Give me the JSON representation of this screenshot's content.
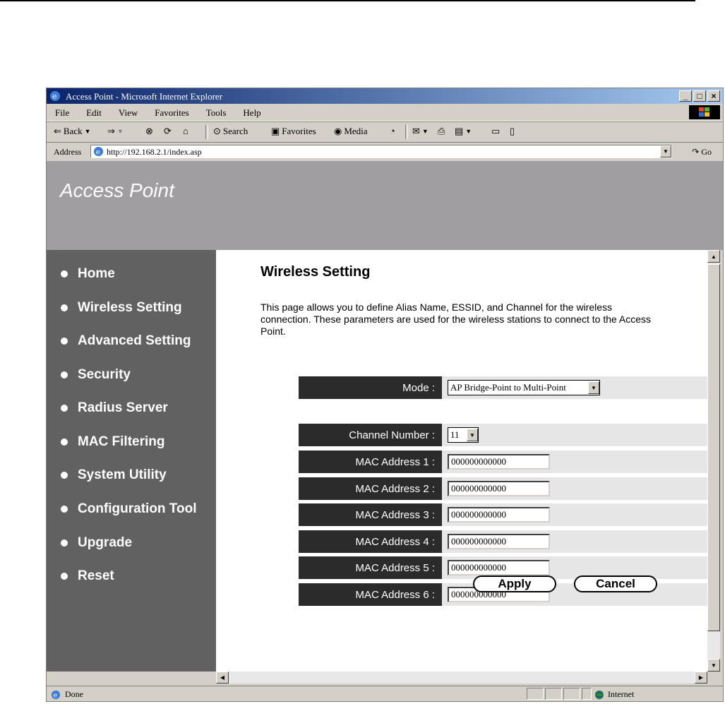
{
  "window": {
    "title": "Access Point - Microsoft Internet Explorer",
    "controls": {
      "minimize": "_",
      "maximize": "□",
      "close": "×"
    }
  },
  "menu": [
    "File",
    "Edit",
    "View",
    "Favorites",
    "Tools",
    "Help"
  ],
  "toolbar": {
    "back_label": "Back",
    "search_label": "Search",
    "favorites_label": "Favorites",
    "media_label": "Media"
  },
  "address": {
    "label": "Address",
    "url": "http://192.168.2.1/index.asp",
    "go_label": "Go"
  },
  "header": {
    "brand": "Access Point"
  },
  "sidebar": {
    "items": [
      {
        "label": "Home"
      },
      {
        "label": "Wireless Setting"
      },
      {
        "label": "Advanced Setting"
      },
      {
        "label": "Security"
      },
      {
        "label": "Radius Server"
      },
      {
        "label": "MAC Filtering"
      },
      {
        "label": "System Utility"
      },
      {
        "label": "Configuration Tool"
      },
      {
        "label": "Upgrade"
      },
      {
        "label": "Reset"
      }
    ]
  },
  "main": {
    "title": "Wireless Setting",
    "description": "This page allows you to define Alias Name, ESSID, and Channel for the wireless connection. These parameters are used for the wireless stations to connect to the Access Point.",
    "mode": {
      "label": "Mode :",
      "value": "AP Bridge-Point to Multi-Point"
    },
    "channel": {
      "label": "Channel Number :",
      "value": "11"
    },
    "mac_addresses": [
      {
        "label": "MAC Address 1 :",
        "value": "000000000000"
      },
      {
        "label": "MAC Address 2 :",
        "value": "000000000000"
      },
      {
        "label": "MAC Address 3 :",
        "value": "000000000000"
      },
      {
        "label": "MAC Address 4 :",
        "value": "000000000000"
      },
      {
        "label": "MAC Address 5 :",
        "value": "000000000000"
      },
      {
        "label": "MAC Address 6 :",
        "value": "000000000000"
      }
    ],
    "apply_label": "Apply",
    "cancel_label": "Cancel"
  },
  "status": {
    "text": "Done",
    "zone": "Internet"
  },
  "colors": {
    "header_bg": "#a09ea1",
    "sidebar_bg": "#616161",
    "label_bg": "#2b2b2b",
    "row_bg": "#e6e6e6"
  }
}
